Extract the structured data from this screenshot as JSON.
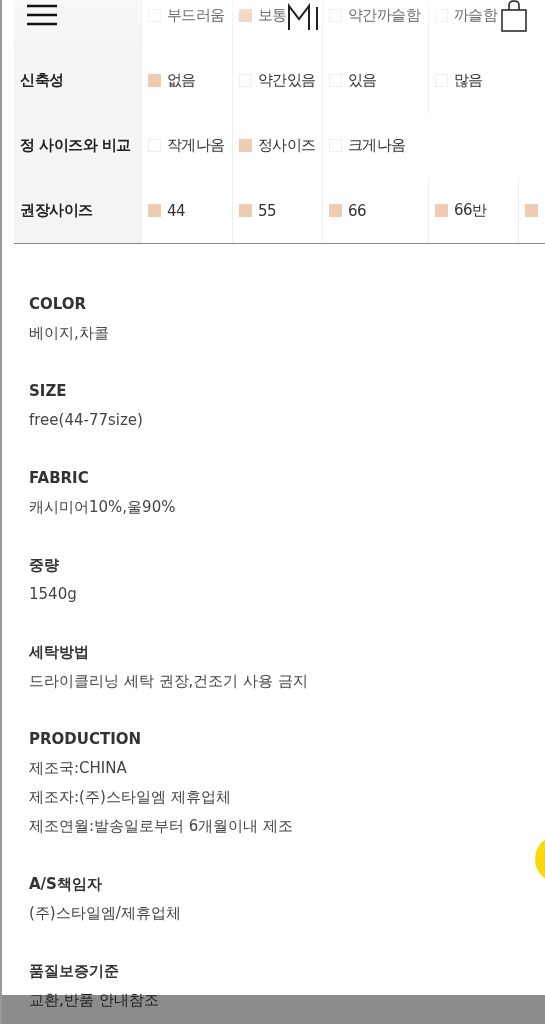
{
  "spec_rows": [
    {
      "options": [
        {
          "label": "부드러움",
          "checked": false
        },
        {
          "label": "보통",
          "checked": true
        },
        {
          "label": "약간까슬함",
          "checked": false
        },
        {
          "label": "까슬함",
          "checked": false
        }
      ]
    },
    {
      "label": "신축성",
      "options": [
        {
          "label": "없음",
          "checked": true
        },
        {
          "label": "약간있음",
          "checked": false
        },
        {
          "label": "있음",
          "checked": false
        },
        {
          "label": "많음",
          "checked": false
        }
      ]
    },
    {
      "label": "정 사이즈와 비교",
      "options": [
        {
          "label": "작게나옴",
          "checked": false
        },
        {
          "label": "정사이즈",
          "checked": true
        },
        {
          "label": "크게나옴",
          "checked": false
        }
      ]
    },
    {
      "label": "권장사이즈",
      "options": [
        {
          "label": "44",
          "checked": true
        },
        {
          "label": "55",
          "checked": true
        },
        {
          "label": "66",
          "checked": true
        },
        {
          "label": "66반",
          "checked": true
        },
        {
          "checked": true
        }
      ]
    }
  ],
  "details": [
    {
      "title": "COLOR",
      "lines": [
        "베이지,차콜"
      ]
    },
    {
      "title": "SIZE",
      "lines": [
        "free(44-77size)"
      ]
    },
    {
      "title": "FABRIC",
      "lines": [
        "캐시미어10%,울90%"
      ]
    },
    {
      "title": "중량",
      "lines": [
        "1540g"
      ]
    },
    {
      "title": "세탁방법",
      "lines": [
        "드라이클리닝 세탁 권장,건조기 사용 금지"
      ]
    },
    {
      "title": "PRODUCTION",
      "lines": [
        "제조국:CHINA",
        "제조자:(주)스타일엠 제휴업체",
        "제조연월:발송일로부터 6개월이내 제조"
      ]
    },
    {
      "title": "A/S책임자",
      "lines": [
        "(주)스타일엠/제휴업체"
      ]
    },
    {
      "title": "품질보증기준",
      "lines": [
        "교환,반품 안내참조"
      ]
    }
  ]
}
